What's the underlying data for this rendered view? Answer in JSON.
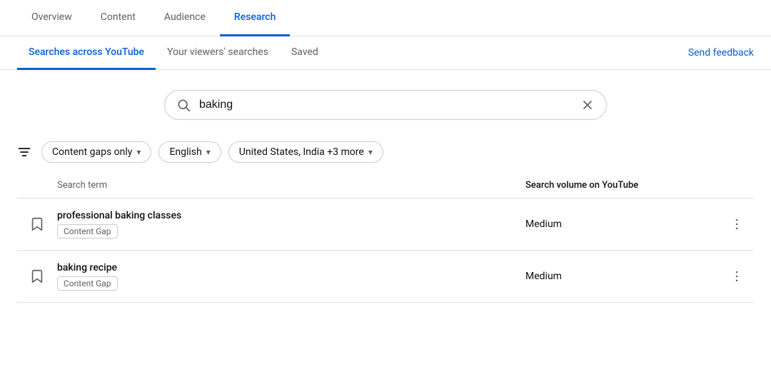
{
  "topNav": {
    "tabs": [
      {
        "id": "overview",
        "label": "Overview",
        "active": false
      },
      {
        "id": "content",
        "label": "Content",
        "active": false
      },
      {
        "id": "audience",
        "label": "Audience",
        "active": false
      },
      {
        "id": "research",
        "label": "Research",
        "active": true
      }
    ]
  },
  "subNav": {
    "tabs": [
      {
        "id": "searches-across-youtube",
        "label": "Searches across YouTube",
        "active": true
      },
      {
        "id": "your-viewers-searches",
        "label": "Your viewers' searches",
        "active": false
      },
      {
        "id": "saved",
        "label": "Saved",
        "active": false
      }
    ],
    "sendFeedback": "Send feedback"
  },
  "search": {
    "value": "baking",
    "placeholder": "Search"
  },
  "filters": {
    "label": "",
    "chips": [
      {
        "id": "content-gaps",
        "label": "Content gaps only"
      },
      {
        "id": "language",
        "label": "English"
      },
      {
        "id": "region",
        "label": "United States, India +3 more"
      }
    ]
  },
  "table": {
    "columns": {
      "term": "Search term",
      "volume": "Search volume on YouTube"
    },
    "rows": [
      {
        "title": "professional baking classes",
        "badge": "Content Gap",
        "volume": "Medium"
      },
      {
        "title": "baking recipe",
        "badge": "Content Gap",
        "volume": "Medium"
      }
    ]
  }
}
